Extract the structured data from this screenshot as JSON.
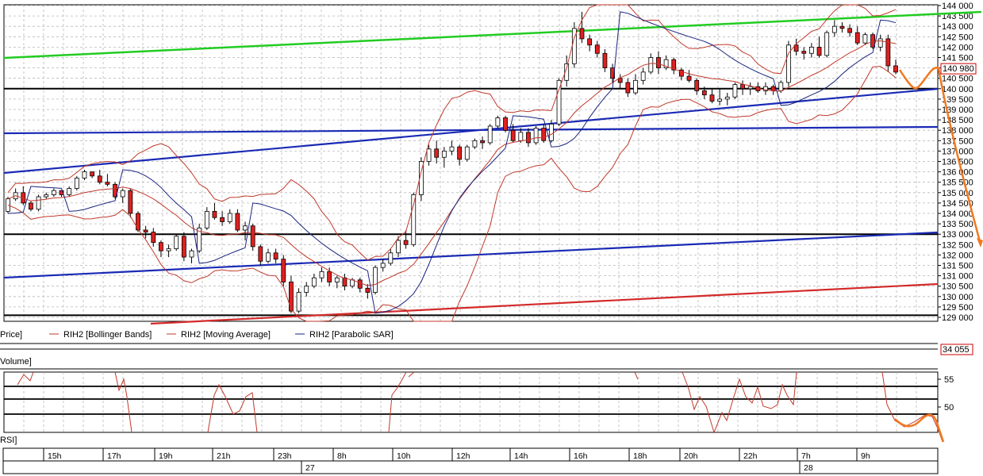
{
  "price_panel": {
    "label": "Price]",
    "legend": [
      {
        "text": "RIH2 [Bollinger Bands]",
        "color": "#c0392b"
      },
      {
        "text": "RIH2 [Moving Average]",
        "color": "#c0392b"
      },
      {
        "text": "RIH2 [Parabolic SAR]",
        "color": "#1a237e"
      }
    ],
    "price_tag": "140 980"
  },
  "volume_panel": {
    "label": "Volume]",
    "value_tag": "34 055"
  },
  "rsi_panel": {
    "label": "RSI]"
  },
  "time_axis": {
    "hour_labels": [
      "15h",
      "17h",
      "19h",
      "21h",
      "23h",
      "8h",
      "10h",
      "12h",
      "14h",
      "16h",
      "18h",
      "20h",
      "22h",
      "7h",
      "9h"
    ],
    "day_labels": [
      "27",
      "28"
    ]
  },
  "colors": {
    "grid": "#b8b8b8",
    "up": "#ffffff",
    "down": "#e02020",
    "trend_green": "#22cc22",
    "trend_blue": "#1a2ab5",
    "trend_red": "#d32a2a",
    "forecast": "#f07820",
    "sar": "#1a237e",
    "bands": "#c0392b"
  },
  "chart_data": [
    {
      "type": "candlestick",
      "title": "",
      "y_ticks": [
        "144 000",
        "143 500",
        "143 000",
        "142 500",
        "142 000",
        "141 500",
        "141 000",
        "140 500",
        "140 000",
        "139 500",
        "139 000",
        "138 500",
        "138 000",
        "137 500",
        "137 000",
        "136 500",
        "136 000",
        "135 500",
        "135 000",
        "134 500",
        "134 000",
        "133 500",
        "133 000",
        "132 500",
        "132 000",
        "131 500",
        "131 000",
        "130 500",
        "130 000",
        "129 500",
        "129 000"
      ],
      "ylim": [
        128800,
        144200
      ],
      "last_price": 140980,
      "candles": [
        [
          134100,
          134800,
          134000,
          134700
        ],
        [
          134700,
          135200,
          134600,
          135000
        ],
        [
          135000,
          135300,
          134400,
          134500
        ],
        [
          134500,
          134600,
          134100,
          134200
        ],
        [
          134200,
          134900,
          134100,
          134800
        ],
        [
          134800,
          135000,
          134700,
          134900
        ],
        [
          134900,
          135200,
          134800,
          135100
        ],
        [
          135100,
          135100,
          134800,
          134900
        ],
        [
          134900,
          135300,
          134800,
          135200
        ],
        [
          135200,
          135800,
          135100,
          135700
        ],
        [
          135700,
          136100,
          135600,
          136000
        ],
        [
          136000,
          136000,
          135700,
          135800
        ],
        [
          135800,
          136100,
          135400,
          135500
        ],
        [
          135500,
          135900,
          135300,
          135400
        ],
        [
          135400,
          135500,
          134700,
          134800
        ],
        [
          134800,
          135200,
          134500,
          135100
        ],
        [
          135100,
          135200,
          133800,
          134000
        ],
        [
          134000,
          134100,
          133100,
          133200
        ],
        [
          133200,
          133400,
          132800,
          133100
        ],
        [
          133100,
          133300,
          132400,
          132600
        ],
        [
          132600,
          132700,
          131900,
          132200
        ],
        [
          132200,
          132500,
          131900,
          132300
        ],
        [
          132300,
          133000,
          132200,
          132900
        ],
        [
          132900,
          133100,
          131700,
          131900
        ],
        [
          131900,
          132300,
          131600,
          132200
        ],
        [
          132200,
          133500,
          132100,
          133300
        ],
        [
          133300,
          134300,
          133200,
          134100
        ],
        [
          134100,
          134500,
          133700,
          133800
        ],
        [
          133800,
          134100,
          133400,
          133600
        ],
        [
          133600,
          134200,
          133500,
          134000
        ],
        [
          134000,
          134200,
          133100,
          133200
        ],
        [
          133200,
          133600,
          132700,
          133400
        ],
        [
          133400,
          133500,
          132200,
          132400
        ],
        [
          132400,
          132500,
          131500,
          131700
        ],
        [
          131700,
          132300,
          131600,
          132100
        ],
        [
          132100,
          132300,
          131600,
          131800
        ],
        [
          131800,
          132000,
          130500,
          130700
        ],
        [
          130700,
          131000,
          129200,
          129300
        ],
        [
          129300,
          130400,
          129200,
          130200
        ],
        [
          130200,
          130700,
          130000,
          130500
        ],
        [
          130500,
          131100,
          130400,
          130900
        ],
        [
          130900,
          131400,
          130700,
          131200
        ],
        [
          131200,
          131400,
          130500,
          130700
        ],
        [
          130700,
          131000,
          130400,
          130900
        ],
        [
          130900,
          131100,
          130300,
          130500
        ],
        [
          130500,
          130900,
          130400,
          130800
        ],
        [
          130800,
          130900,
          130200,
          130400
        ],
        [
          130400,
          130600,
          129900,
          130200
        ],
        [
          130200,
          131500,
          130100,
          131400
        ],
        [
          131400,
          131800,
          131200,
          131600
        ],
        [
          131600,
          132300,
          131500,
          132100
        ],
        [
          132100,
          132900,
          131900,
          132700
        ],
        [
          132700,
          133200,
          132300,
          132500
        ],
        [
          132500,
          135000,
          132400,
          134900
        ],
        [
          134900,
          136700,
          134600,
          136500
        ],
        [
          136500,
          137300,
          136300,
          137100
        ],
        [
          137100,
          137500,
          136400,
          136700
        ],
        [
          136700,
          137200,
          136200,
          137000
        ],
        [
          137000,
          137500,
          136800,
          137200
        ],
        [
          137200,
          137300,
          136300,
          136600
        ],
        [
          136600,
          137300,
          136500,
          137200
        ],
        [
          137200,
          137600,
          137100,
          137500
        ],
        [
          137500,
          137700,
          137100,
          137400
        ],
        [
          137400,
          138300,
          137300,
          138200
        ],
        [
          138200,
          138700,
          138100,
          138600
        ],
        [
          138600,
          138700,
          137900,
          138000
        ],
        [
          138000,
          138300,
          137400,
          137500
        ],
        [
          137500,
          138100,
          137400,
          137900
        ],
        [
          137900,
          138100,
          137200,
          137400
        ],
        [
          137400,
          138200,
          137300,
          138100
        ],
        [
          138100,
          138300,
          137400,
          137500
        ],
        [
          137500,
          138500,
          137400,
          138300
        ],
        [
          138300,
          140500,
          138200,
          140400
        ],
        [
          140400,
          141600,
          140100,
          141200
        ],
        [
          141200,
          143200,
          141000,
          142900
        ],
        [
          142900,
          143700,
          142200,
          142400
        ],
        [
          142400,
          142600,
          141800,
          142100
        ],
        [
          142100,
          142300,
          141500,
          141700
        ],
        [
          141700,
          141900,
          140800,
          141000
        ],
        [
          141000,
          141200,
          140300,
          140500
        ],
        [
          140500,
          140700,
          140000,
          140300
        ],
        [
          140300,
          140500,
          139600,
          139800
        ],
        [
          139800,
          140700,
          139700,
          140400
        ],
        [
          140400,
          141000,
          140200,
          140800
        ],
        [
          140800,
          141700,
          140700,
          141500
        ],
        [
          141500,
          141800,
          140700,
          141000
        ],
        [
          141000,
          141600,
          140900,
          141400
        ],
        [
          141400,
          141500,
          140700,
          140900
        ],
        [
          140900,
          141000,
          140400,
          140600
        ],
        [
          140600,
          140900,
          140300,
          140400
        ],
        [
          140400,
          140500,
          139700,
          139900
        ],
        [
          139900,
          140100,
          139500,
          139700
        ],
        [
          139700,
          140000,
          139300,
          139400
        ],
        [
          139400,
          140000,
          139200,
          139500
        ],
        [
          139500,
          139800,
          139200,
          139600
        ],
        [
          139600,
          140300,
          139500,
          140200
        ],
        [
          140200,
          140400,
          139700,
          140000
        ],
        [
          140000,
          140300,
          139700,
          140100
        ],
        [
          140100,
          140300,
          139800,
          139900
        ],
        [
          139900,
          140300,
          139700,
          140100
        ],
        [
          140100,
          140200,
          139700,
          139900
        ],
        [
          139900,
          140400,
          139800,
          140300
        ],
        [
          140300,
          142300,
          140100,
          142100
        ],
        [
          142100,
          142400,
          141600,
          141800
        ],
        [
          141800,
          142000,
          141400,
          141700
        ],
        [
          141700,
          142200,
          141500,
          142000
        ],
        [
          142000,
          142500,
          141500,
          141600
        ],
        [
          141600,
          142800,
          141500,
          142700
        ],
        [
          142700,
          143300,
          142500,
          143000
        ],
        [
          143000,
          143200,
          142700,
          142900
        ],
        [
          142900,
          143100,
          142500,
          142700
        ],
        [
          142700,
          143000,
          142100,
          142200
        ],
        [
          142200,
          142700,
          142100,
          142600
        ],
        [
          142600,
          142700,
          141900,
          142000
        ],
        [
          142000,
          142600,
          141800,
          142400
        ],
        [
          142400,
          142600,
          140800,
          141100
        ],
        [
          141100,
          141400,
          140700,
          140800
        ]
      ],
      "series": [
        {
          "name": "RIH2 [Moving Average]"
        },
        {
          "name": "RIH2 [Bollinger Bands]"
        },
        {
          "name": "RIH2 [Parabolic SAR]"
        }
      ]
    },
    {
      "type": "line",
      "title": "",
      "y_ticks": [
        "55",
        "50"
      ],
      "ylim": [
        45,
        56
      ]
    }
  ]
}
